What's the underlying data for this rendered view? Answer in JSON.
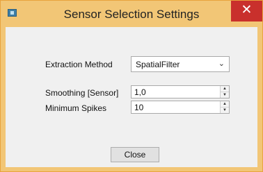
{
  "window": {
    "title": "Sensor Selection Settings",
    "close_glyph": "✕",
    "app_icon": "app-icon"
  },
  "form": {
    "extraction_method": {
      "label": "Extraction Method",
      "value": "SpatialFilter"
    },
    "smoothing": {
      "label": "Smoothing [Sensor]",
      "value": "1,0"
    },
    "min_spikes": {
      "label": "Minimum Spikes",
      "value": "10"
    }
  },
  "footer": {
    "close_label": "Close"
  },
  "colors": {
    "frame": "#f2c676",
    "close_button": "#c9302c",
    "client_bg": "#f0f0f0"
  }
}
